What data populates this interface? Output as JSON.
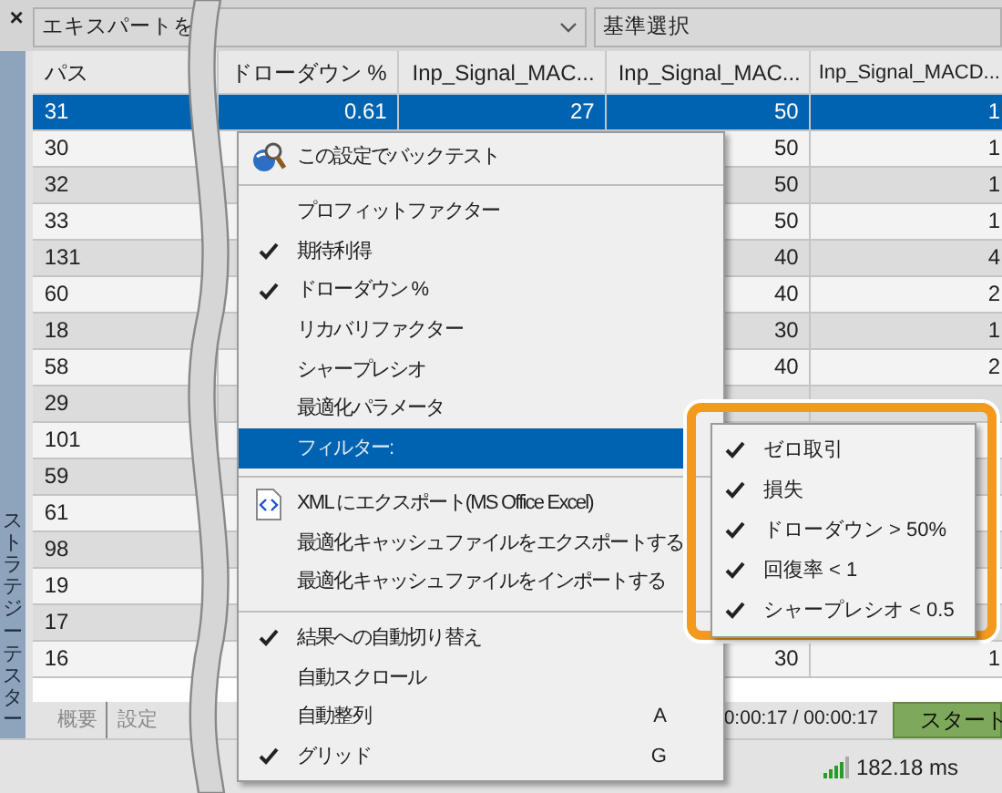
{
  "panel": {
    "close": "×",
    "expert_select": {
      "value": "エキスパートを"
    },
    "criteria_select": {
      "value": "基準選択"
    },
    "side_tab": "ストラテジーテスター"
  },
  "table": {
    "columns": [
      "パス",
      "ドローダウン %",
      "Inp_Signal_MAC...",
      "Inp_Signal_MAC...",
      "Inp_Signal_MACD..."
    ],
    "rows": [
      {
        "cells": [
          "31",
          "0.61",
          "27",
          "50",
          "1"
        ],
        "selected": true
      },
      {
        "cells": [
          "30",
          null,
          null,
          "50",
          "1"
        ],
        "selected": false
      },
      {
        "cells": [
          "32",
          null,
          null,
          "50",
          "1"
        ],
        "selected": false
      },
      {
        "cells": [
          "33",
          null,
          null,
          "50",
          "1"
        ],
        "selected": false
      },
      {
        "cells": [
          "131",
          null,
          null,
          "40",
          "4"
        ],
        "selected": false
      },
      {
        "cells": [
          "60",
          null,
          null,
          "40",
          "2"
        ],
        "selected": false
      },
      {
        "cells": [
          "18",
          null,
          null,
          "30",
          "1"
        ],
        "selected": false
      },
      {
        "cells": [
          "58",
          null,
          null,
          "40",
          "2"
        ],
        "selected": false
      },
      {
        "cells": [
          "29",
          null,
          null,
          null,
          null
        ],
        "selected": false
      },
      {
        "cells": [
          "101",
          null,
          null,
          null,
          null
        ],
        "selected": false
      },
      {
        "cells": [
          "59",
          null,
          null,
          null,
          null
        ],
        "selected": false
      },
      {
        "cells": [
          "61",
          null,
          null,
          null,
          null
        ],
        "selected": false
      },
      {
        "cells": [
          "98",
          null,
          null,
          null,
          null
        ],
        "selected": false
      },
      {
        "cells": [
          "19",
          null,
          null,
          null,
          null
        ],
        "selected": false
      },
      {
        "cells": [
          "17",
          null,
          null,
          null,
          null
        ],
        "selected": false
      },
      {
        "cells": [
          "16",
          null,
          null,
          "30",
          "1"
        ],
        "selected": false
      }
    ]
  },
  "bottom_tabs": [
    "概要",
    "設定"
  ],
  "timer": "0:00:17 / 00:00:17",
  "start_button": "スタート",
  "status_bar": {
    "ping": "182.18 ms"
  },
  "context_menu": {
    "items": [
      {
        "kind": "backtest",
        "label": "この設定でバックテスト",
        "selected": false
      },
      {
        "kind": "separator"
      },
      {
        "kind": "check",
        "label": "プロフィットファクター",
        "checked": false,
        "selected": false
      },
      {
        "kind": "check",
        "label": "期待利得",
        "checked": true,
        "selected": false
      },
      {
        "kind": "check",
        "label": "ドローダウン %",
        "checked": true,
        "selected": false
      },
      {
        "kind": "check",
        "label": "リカバリファクター",
        "checked": false,
        "selected": false
      },
      {
        "kind": "check",
        "label": "シャープレシオ",
        "checked": false,
        "selected": false
      },
      {
        "kind": "check",
        "label": "最適化パラメータ",
        "checked": false,
        "selected": false
      },
      {
        "kind": "check",
        "label": "フィルター:",
        "checked": false,
        "selected": true
      },
      {
        "kind": "separator"
      },
      {
        "kind": "export",
        "label": "XML にエクスポート(MS Office Excel)",
        "selected": false
      },
      {
        "kind": "check",
        "label": "最適化キャッシュファイルをエクスポートする",
        "checked": false,
        "selected": false
      },
      {
        "kind": "check",
        "label": "最適化キャッシュファイルをインポートする",
        "checked": false,
        "selected": false
      },
      {
        "kind": "separator"
      },
      {
        "kind": "check",
        "label": "結果への自動切り替え",
        "checked": true,
        "selected": false
      },
      {
        "kind": "check",
        "label": "自動スクロール",
        "checked": false,
        "selected": false
      },
      {
        "kind": "check",
        "label": "自動整列",
        "checked": false,
        "selected": false,
        "shortcut": "A"
      },
      {
        "kind": "check",
        "label": "グリッド",
        "checked": true,
        "selected": false,
        "shortcut": "G"
      }
    ]
  },
  "filter_submenu": {
    "items": [
      {
        "label": "ゼロ取引",
        "checked": true
      },
      {
        "label": "損失",
        "checked": true
      },
      {
        "label": "ドローダウン > 50%",
        "checked": true
      },
      {
        "label": "回復率 < 1",
        "checked": true
      },
      {
        "label": "シャープレシオ < 0.5",
        "checked": true
      }
    ]
  }
}
